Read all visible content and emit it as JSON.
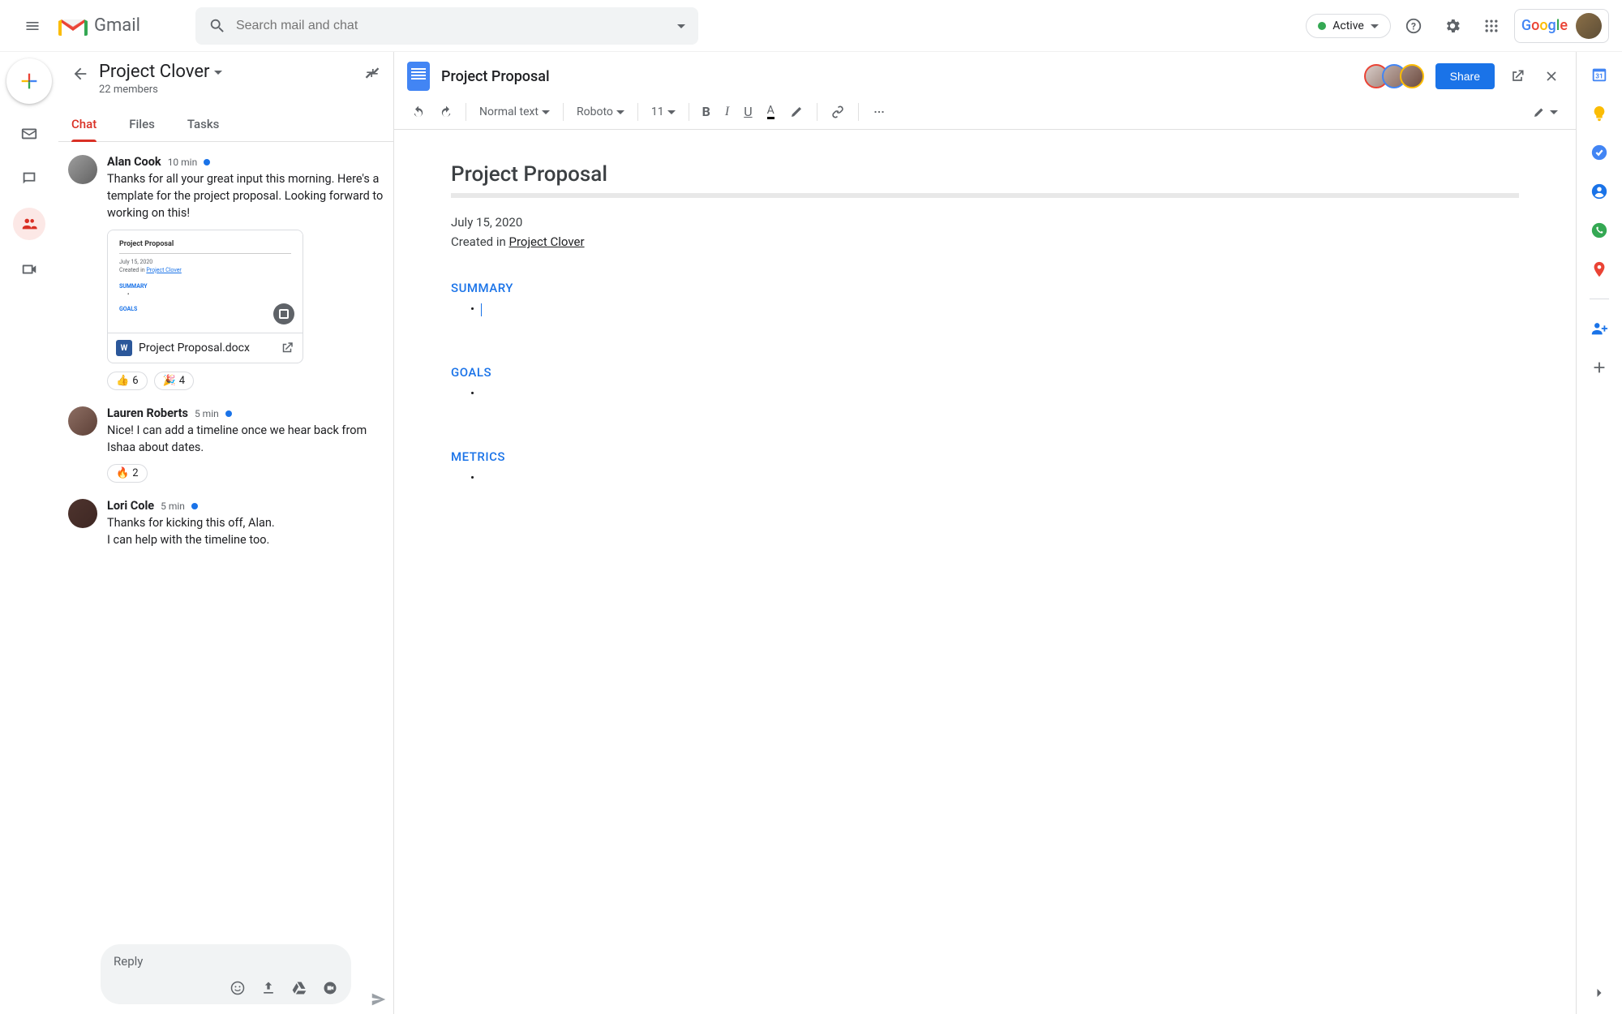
{
  "header": {
    "app_name": "Gmail",
    "search_placeholder": "Search mail and chat",
    "status_label": "Active"
  },
  "google_logo": {
    "g": "G",
    "o1": "o",
    "o2": "o",
    "g2": "g",
    "l": "l",
    "e": "e"
  },
  "chat": {
    "title": "Project Clover",
    "subtitle": "22 members",
    "tabs": {
      "chat": "Chat",
      "files": "Files",
      "tasks": "Tasks"
    },
    "reply_placeholder": "Reply"
  },
  "messages": [
    {
      "author": "Alan Cook",
      "time": "10 min",
      "text": "Thanks for all your great input this morning. Here's a template for the project proposal. Looking forward to working on this!",
      "attachment": {
        "preview_title": "Project Proposal",
        "preview_date": "July 15, 2020",
        "preview_created": "Created in ",
        "preview_link": "Project Clover",
        "preview_sec1": "SUMMARY",
        "preview_sec2": "GOALS",
        "filename": "Project Proposal.docx"
      },
      "reactions": [
        {
          "emoji": "👍",
          "count": "6"
        },
        {
          "emoji": "🎉",
          "count": "4"
        }
      ]
    },
    {
      "author": "Lauren Roberts",
      "time": "5 min",
      "text": "Nice! I can add a timeline once we hear back from Ishaa about dates.",
      "reactions": [
        {
          "emoji": "🔥",
          "count": "2"
        }
      ]
    },
    {
      "author": "Lori Cole",
      "time": "5 min",
      "text_l1": "Thanks for kicking this off, Alan.",
      "text_l2": "I can help with the timeline too."
    }
  ],
  "doc": {
    "title": "Project Proposal",
    "share_label": "Share",
    "toolbar": {
      "style": "Normal text",
      "font": "Roboto",
      "size": "11"
    },
    "content": {
      "heading": "Project Proposal",
      "date": "July 15, 2020",
      "created_prefix": "Created in ",
      "created_link": "Project Clover",
      "section_summary": "SUMMARY",
      "section_goals": "GOALS",
      "section_metrics": "METRICS"
    }
  }
}
